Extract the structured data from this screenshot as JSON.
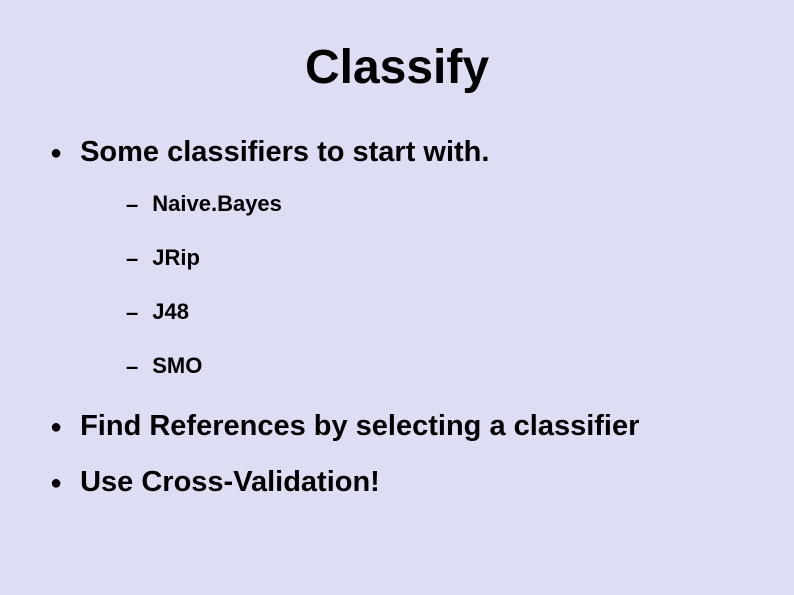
{
  "title": "Classify",
  "bullets": [
    {
      "text": "Some classifiers to start with.",
      "subitems": [
        "Naive.Bayes",
        "JRip",
        "J48",
        "SMO"
      ]
    },
    {
      "text": "Find References by selecting a classifier",
      "subitems": []
    },
    {
      "text": "Use Cross-Validation!",
      "subitems": []
    }
  ]
}
